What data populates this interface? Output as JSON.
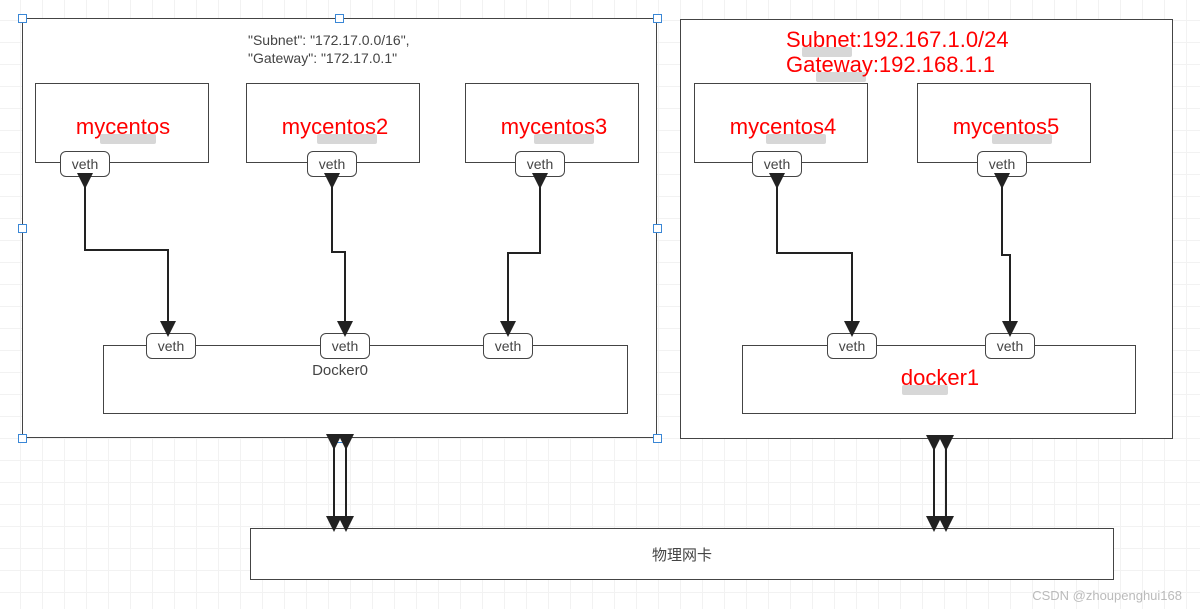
{
  "group1": {
    "config_line1": "\"Subnet\": \"172.17.0.0/16\",",
    "config_line2": "\"Gateway\": \"172.17.0.1\"",
    "containers": [
      {
        "label": "mycentos",
        "veth_top": "veth",
        "veth_bottom": "veth"
      },
      {
        "label": "mycentos2",
        "veth_top": "veth",
        "veth_bottom": "veth"
      },
      {
        "label": "mycentos3",
        "veth_top": "veth",
        "veth_bottom": "veth"
      }
    ],
    "bridge_label": "Docker0"
  },
  "group2": {
    "config_line1": "Subnet:192.167.1.0/24",
    "config_line2": "Gateway:192.168.1.1",
    "containers": [
      {
        "label": "mycentos4",
        "veth_top": "veth",
        "veth_bottom": "veth"
      },
      {
        "label": "mycentos5",
        "veth_top": "veth",
        "veth_bottom": "veth"
      }
    ],
    "bridge_label": "docker1"
  },
  "physical_nic": "物理网卡",
  "watermark": "CSDN @zhoupenghui168"
}
